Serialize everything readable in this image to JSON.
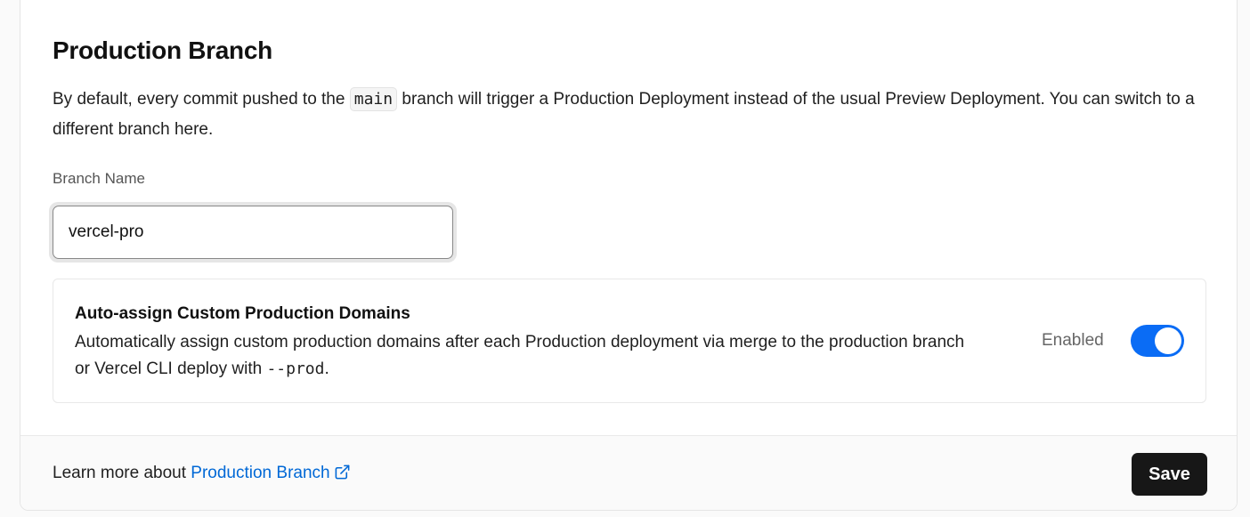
{
  "section": {
    "title": "Production Branch",
    "description_pre": "By default, every commit pushed to the",
    "description_code": "main",
    "description_post": "branch will trigger a Production Deployment instead of the usual Preview Deployment. You can switch to a different branch here."
  },
  "branch_field": {
    "label": "Branch Name",
    "value": "vercel-pro"
  },
  "auto_assign": {
    "title": "Auto-assign Custom Production Domains",
    "description_pre": "Automatically assign custom production domains after each Production deployment via merge to the production branch or Vercel CLI deploy with",
    "description_code": "--prod",
    "description_post": ".",
    "status_label": "Enabled",
    "enabled": true,
    "toggle_color": "#0a6cf5"
  },
  "footer": {
    "learn_prefix": "Learn more about",
    "learn_link": "Production Branch",
    "link_icon": "external-link-icon",
    "save_label": "Save"
  },
  "colors": {
    "accent": "#0a6cf5",
    "link": "#0068d6",
    "button_bg": "#171717"
  }
}
